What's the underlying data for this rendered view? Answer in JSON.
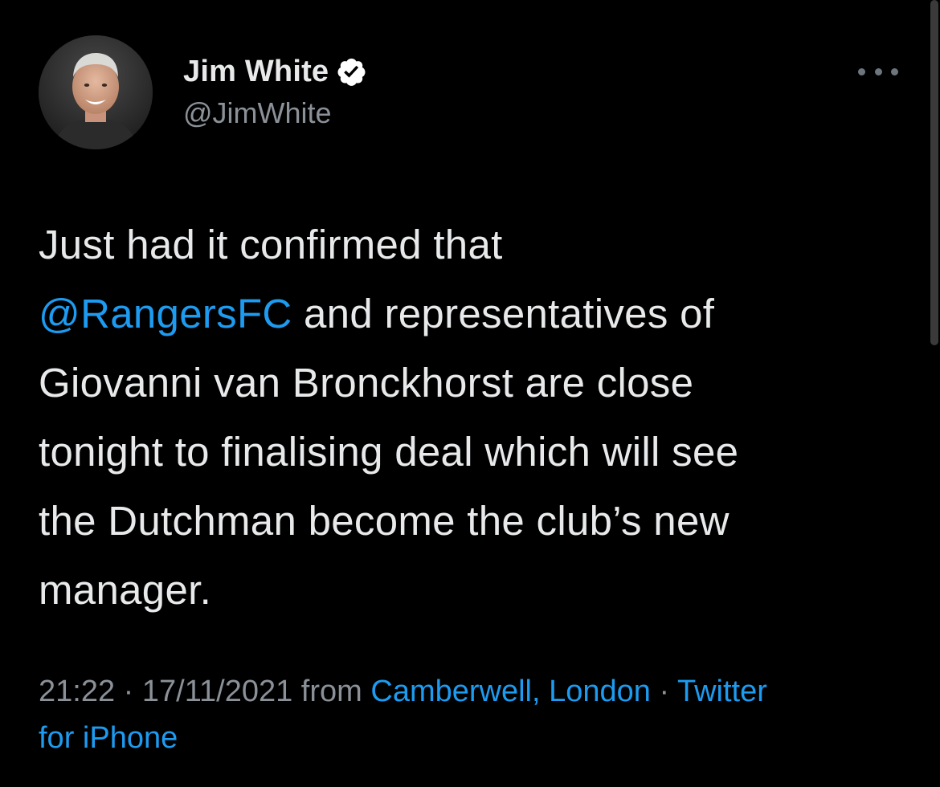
{
  "author": {
    "display_name": "Jim White",
    "handle": "@JimWhite",
    "verified": true,
    "avatar_icon": "profile-photo"
  },
  "more_icon": "more-dots-icon",
  "tweet": {
    "line1": "Just had it confirmed that",
    "mention": "@RangersFC",
    "line2_rest": " and representatives of",
    "line3": "Giovanni van Bronckhorst are close",
    "line4": "tonight to finalising deal which will see",
    "line5": "the Dutchman become the club’s new",
    "line6": "manager."
  },
  "meta": {
    "time": "21:22",
    "sep1": " · ",
    "date": "17/11/2021",
    "from": " from ",
    "location": "Camberwell, London",
    "sep2": " · ",
    "source_part1": "Twitter",
    "source_part2": "for iPhone"
  },
  "colors": {
    "background": "#000000",
    "text": "#e7e9ea",
    "secondary": "#8b9198",
    "accent": "#1d9bf0"
  }
}
